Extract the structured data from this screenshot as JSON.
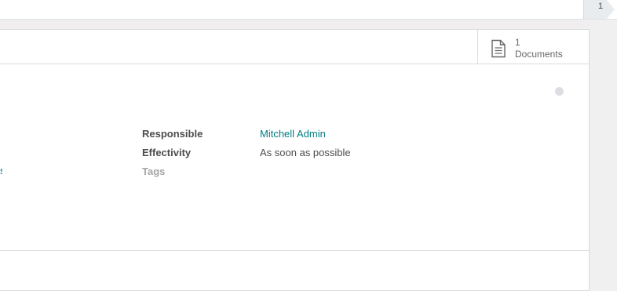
{
  "statusbar": {
    "current_step": "1"
  },
  "smart_buttons": {
    "documents": {
      "count": "1",
      "label": "Documents",
      "icon": "document-icon"
    }
  },
  "fields": {
    "responsible": {
      "label": "Responsible",
      "value": "Mitchell Admin"
    },
    "effectivity": {
      "label": "Effectivity",
      "value": "As soon as possible"
    },
    "tags": {
      "label": "Tags"
    }
  },
  "truncated_link": {
    "text": "s"
  },
  "colors": {
    "link": "#017e84",
    "label": "#4c4c4c",
    "muted": "#a5a5a5",
    "border": "#d8dadd"
  }
}
